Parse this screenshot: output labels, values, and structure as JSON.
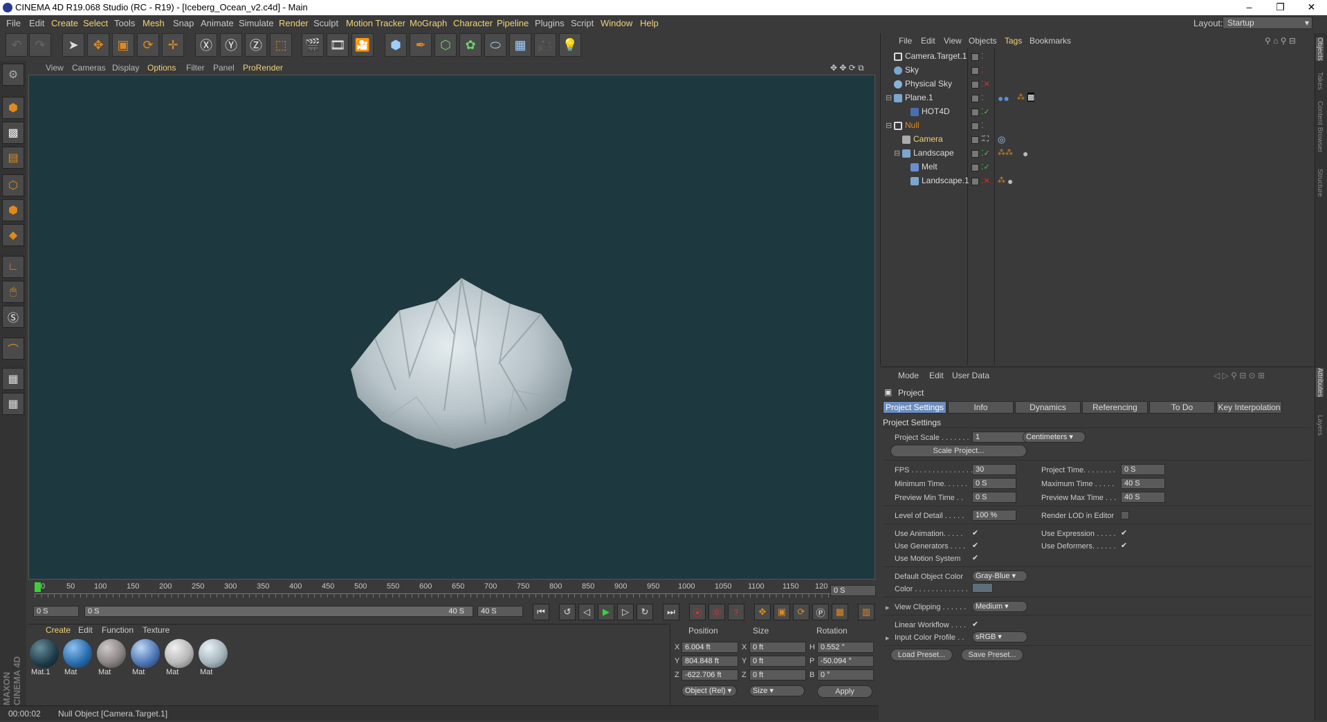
{
  "window": {
    "title": "CINEMA 4D R19.068 Studio (RC - R19) - [Iceberg_Ocean_v2.c4d] - Main"
  },
  "menubar": {
    "items": [
      "File",
      "Edit",
      "Create",
      "Select",
      "Tools",
      "Mesh",
      "Snap",
      "Animate",
      "Simulate",
      "Render",
      "Sculpt",
      "Motion Tracker",
      "MoGraph",
      "Character",
      "Pipeline",
      "Plugins",
      "Script",
      "Window",
      "Help"
    ],
    "layout_label": "Layout:",
    "layout_value": "Startup"
  },
  "viewport_menu": [
    "View",
    "Cameras",
    "Display",
    "Options",
    "Filter",
    "Panel",
    "ProRender"
  ],
  "timeline": {
    "ticks": [
      "0",
      "50",
      "100",
      "150",
      "200",
      "250",
      "300",
      "350",
      "400",
      "450",
      "500",
      "550",
      "600",
      "650",
      "700",
      "750",
      "800",
      "850",
      "900",
      "950",
      "1000",
      "1050",
      "1100",
      "1150",
      "120"
    ],
    "current_frame": "0 S",
    "start": "0 S",
    "range_start": "0 S",
    "range_end": "40 S",
    "end": "40 S"
  },
  "material_manager": {
    "menu": [
      "Create",
      "Edit",
      "Function",
      "Texture"
    ],
    "materials": [
      {
        "label": "Mat.1",
        "color": "#1d3a47"
      },
      {
        "label": "Mat",
        "color": "#2a6fb0"
      },
      {
        "label": "Mat",
        "color": "#8a8484"
      },
      {
        "label": "Mat",
        "color": "#4f79b8"
      },
      {
        "label": "Mat",
        "color": "#b8b8b8"
      },
      {
        "label": "Mat",
        "color": "#a6b5bc"
      }
    ]
  },
  "coordinates": {
    "headers": [
      "Position",
      "Size",
      "Rotation"
    ],
    "rows": [
      {
        "axis": "X",
        "pos": "6.004 ft",
        "saxis": "X",
        "size": "0 ft",
        "raxis": "H",
        "rot": "0.552 °"
      },
      {
        "axis": "Y",
        "pos": "804.848 ft",
        "saxis": "Y",
        "size": "0 ft",
        "raxis": "P",
        "rot": "-50.094 °"
      },
      {
        "axis": "Z",
        "pos": "-622.706 ft",
        "saxis": "Z",
        "size": "0 ft",
        "raxis": "B",
        "rot": "0 °"
      }
    ],
    "mode": "Object (Rel)",
    "size_mode": "Size",
    "apply": "Apply"
  },
  "status": {
    "time": "00:00:02",
    "message": "Null Object [Camera.Target.1]"
  },
  "brand": "MAXON CINEMA 4D",
  "object_manager": {
    "menu": [
      "File",
      "Edit",
      "View",
      "Objects",
      "Tags",
      "Bookmarks"
    ],
    "objects": [
      {
        "name": "Camera.Target.1",
        "highlight": false
      },
      {
        "name": "Sky",
        "highlight": false
      },
      {
        "name": "Physical Sky",
        "highlight": false
      },
      {
        "name": "Plane.1",
        "highlight": false
      },
      {
        "name": "HOT4D",
        "highlight": false
      },
      {
        "name": "Null",
        "highlight": true
      },
      {
        "name": "Camera",
        "highlight": true
      },
      {
        "name": "Landscape",
        "highlight": false
      },
      {
        "name": "Melt",
        "highlight": false
      },
      {
        "name": "Landscape.1",
        "highlight": false
      }
    ]
  },
  "attribute_manager": {
    "menu": [
      "Mode",
      "Edit",
      "User Data"
    ],
    "object": "Project",
    "tabs": [
      "Project Settings",
      "Info",
      "Dynamics",
      "Referencing",
      "To Do",
      "Key Interpolation"
    ],
    "section": "Project Settings",
    "project_scale_label": "Project Scale . . . . . . .",
    "project_scale_value": "1",
    "project_scale_unit": "Centimeters",
    "scale_project_btn": "Scale Project...",
    "fps_label": "FPS . . . . . . . . . . . . . . .",
    "fps_value": "30",
    "project_time_label": "Project Time. . . . . . . .",
    "project_time_value": "0 S",
    "min_time_label": "Minimum Time. . . . . .",
    "min_time_value": "0 S",
    "max_time_label": "Maximum Time . . . . .",
    "max_time_value": "40 S",
    "prev_min_label": "Preview Min Time . .",
    "prev_min_value": "0 S",
    "prev_max_label": "Preview Max Time . . .",
    "prev_max_value": "40 S",
    "lod_label": "Level of Detail . . . . .",
    "lod_value": "100 %",
    "render_lod_label": "Render LOD in Editor",
    "use_anim_label": "Use Animation. . . . .",
    "use_expr_label": "Use Expression . . . . .",
    "use_gen_label": "Use Generators . . . .",
    "use_def_label": "Use Deformers. . . . . .",
    "use_motion_label": "Use Motion System",
    "def_color_label": "Default Object Color",
    "def_color_value": "Gray-Blue",
    "color_label": "Color . . . . . . . . . . . . .",
    "view_clip_label": "View Clipping . . . . . .",
    "view_clip_value": "Medium",
    "linear_label": "Linear Workflow . . . .",
    "input_profile_label": "Input Color Profile . .",
    "input_profile_value": "sRGB",
    "load_preset": "Load Preset...",
    "save_preset": "Save Preset..."
  },
  "right_tabs": [
    "Objects",
    "Takes",
    "Content Browser",
    "Structure",
    "Attributes",
    "Layers"
  ]
}
